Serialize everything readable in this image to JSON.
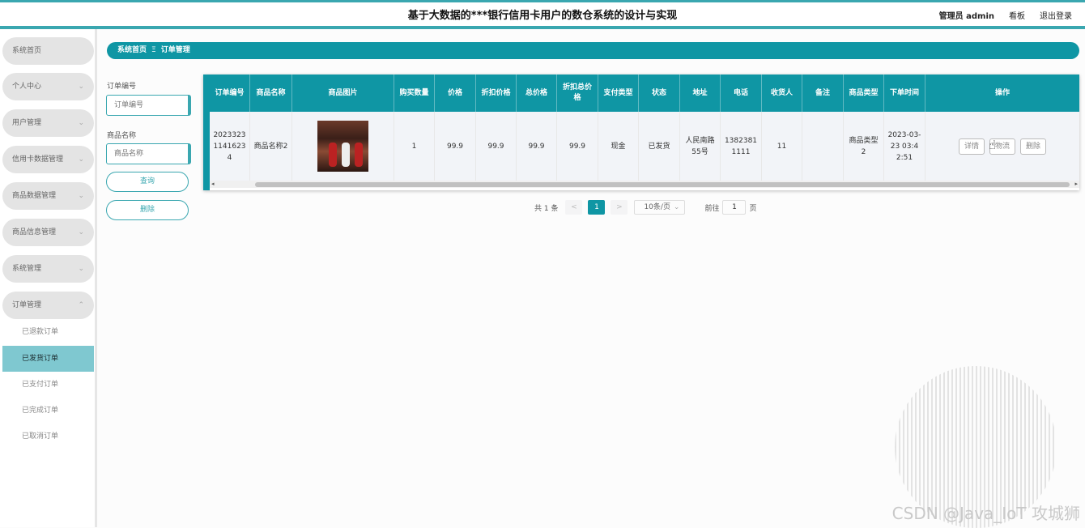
{
  "header": {
    "title": "基于大数据的***银行信用卡用户的数仓系统的设计与实现",
    "user_label": "管理员 admin",
    "dashboard_link": "看板",
    "logout_link": "退出登录"
  },
  "sidebar": {
    "items": [
      {
        "label": "系统首页"
      },
      {
        "label": "个人中心"
      },
      {
        "label": "用户管理"
      },
      {
        "label": "信用卡数据管理"
      },
      {
        "label": "商品数据管理"
      },
      {
        "label": "商品信息管理"
      },
      {
        "label": "系统管理"
      },
      {
        "label": "订单管理"
      }
    ],
    "chevrons": {
      "down": "⌄",
      "up": "⌃"
    },
    "sub_items": [
      {
        "label": "已退款订单"
      },
      {
        "label": "已发货订单"
      },
      {
        "label": "已支付订单"
      },
      {
        "label": "已完成订单"
      },
      {
        "label": "已取消订单"
      }
    ]
  },
  "breadcrumb": {
    "home": "系统首页",
    "separator": "Ξ",
    "current": "订单管理"
  },
  "filters": {
    "order_no_label": "订单编号",
    "order_no_placeholder": "订单编号",
    "product_name_label": "商品名称",
    "product_name_placeholder": "商品名称",
    "query_button": "查询",
    "delete_button": "删除"
  },
  "table": {
    "headers": [
      "订单编号",
      "商品名称",
      "商品图片",
      "购买数量",
      "价格",
      "折扣价格",
      "总价格",
      "折扣总价格",
      "支付类型",
      "状态",
      "地址",
      "电话",
      "收货人",
      "备注",
      "商品类型",
      "下单时间",
      "操作"
    ],
    "row": {
      "order_no": "20233231141623 4",
      "product_name": "商品名称2",
      "quantity": "1",
      "price": "99.9",
      "discount_price": "99.9",
      "total_price": "99.9",
      "discount_total": "99.9",
      "pay_type": "现金",
      "status": "已发货",
      "address": "人民南路55号",
      "phone": "13823811111",
      "receiver": "11",
      "remark": "",
      "product_type": "商品类型2",
      "order_time": "2023-03-23 03:42:51"
    },
    "actions": {
      "detail": "详情",
      "logistics": "物流",
      "delete": "删除"
    },
    "scroll_left": "◂",
    "scroll_right": "▸"
  },
  "pagination": {
    "total_text": "共 1 条",
    "prev": "<",
    "current_page": "1",
    "next": ">",
    "page_size": "10条/页",
    "page_size_icon": "⌄",
    "goto_label": "前往",
    "goto_value": "1",
    "page_suffix": "页"
  },
  "watermark": "CSDN @Java_IoT 攻城狮",
  "cursor_icon": "☝"
}
